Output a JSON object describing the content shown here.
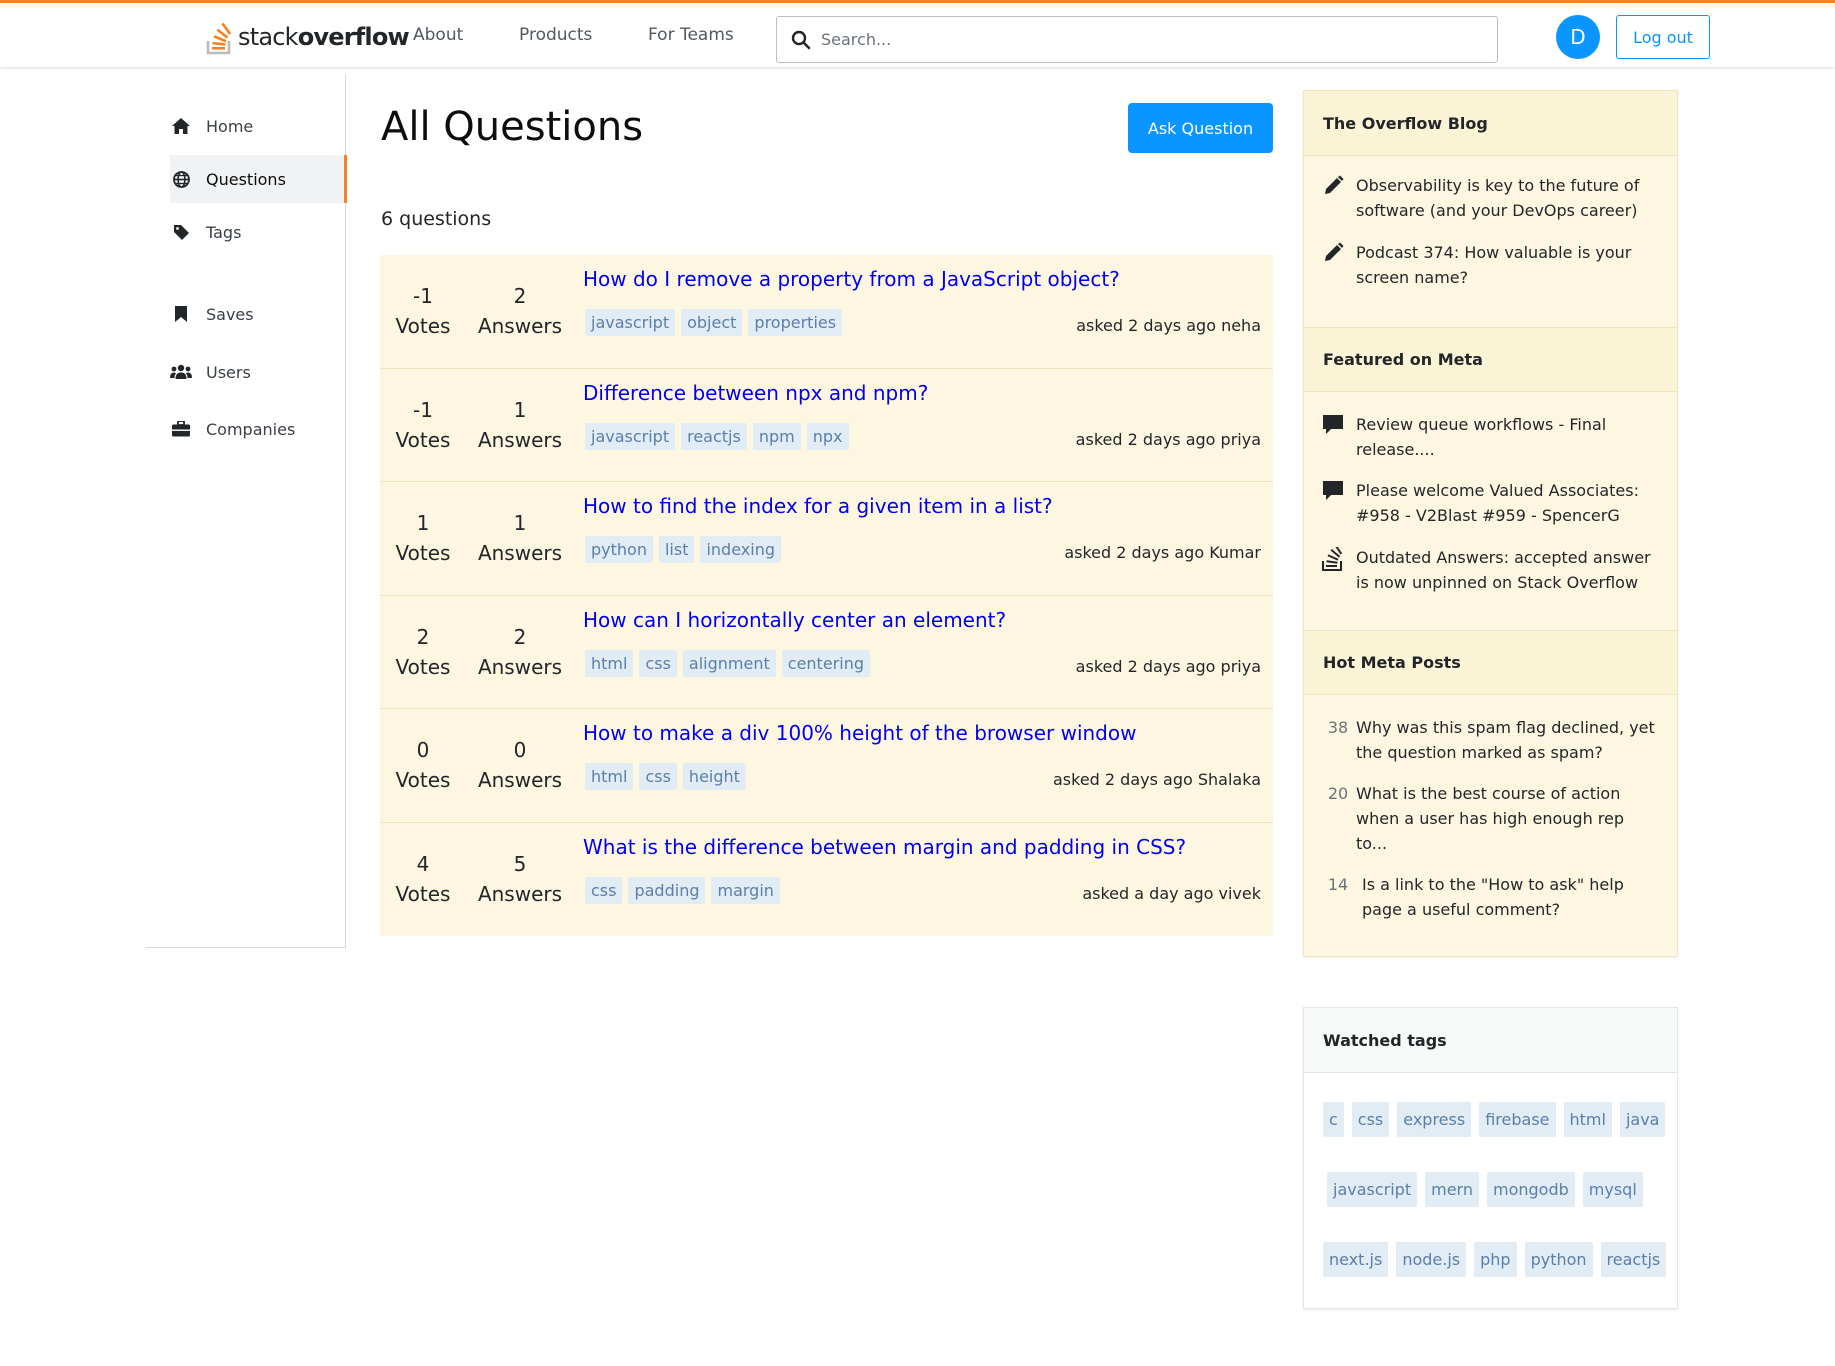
{
  "header": {
    "logo_prefix": "stack",
    "logo_suffix": "overflow",
    "nav": [
      "About",
      "Products",
      "For Teams"
    ],
    "search_placeholder": "Search...",
    "avatar_letter": "D",
    "logout_label": "Log out",
    "accent_color": "#f48225"
  },
  "sidebar": {
    "items": [
      {
        "label": "Home",
        "icon": "home-icon"
      },
      {
        "label": "Questions",
        "icon": "globe-icon",
        "active": true
      },
      {
        "label": "Tags",
        "icon": "tag-icon"
      },
      {
        "label": "Saves",
        "icon": "bookmark-icon"
      },
      {
        "label": "Users",
        "icon": "users-icon"
      },
      {
        "label": "Companies",
        "icon": "briefcase-icon"
      }
    ]
  },
  "main": {
    "title": "All Questions",
    "ask_label": "Ask Question",
    "count_text": "6 questions",
    "votes_label": "Votes",
    "answers_label": "Answers",
    "questions": [
      {
        "votes": "-1",
        "answers": "2",
        "title": "How do I remove a property from a JavaScript object?",
        "tags": [
          "javascript",
          "object",
          "properties"
        ],
        "asked": "asked 2 days ago neha"
      },
      {
        "votes": "-1",
        "answers": "1",
        "title": "Difference between npx and npm?",
        "tags": [
          "javascript",
          "reactjs",
          "npm",
          "npx"
        ],
        "asked": "asked 2 days ago priya"
      },
      {
        "votes": "1",
        "answers": "1",
        "title": "How to find the index for a given item in a list?",
        "tags": [
          "python",
          "list",
          "indexing"
        ],
        "asked": "asked 2 days ago Kumar"
      },
      {
        "votes": "2",
        "answers": "2",
        "title": "How can I horizontally center an element?",
        "tags": [
          "html",
          "css",
          "alignment",
          "centering"
        ],
        "asked": "asked 2 days ago priya"
      },
      {
        "votes": "0",
        "answers": "0",
        "title": "How to make a div 100% height of the browser window",
        "tags": [
          "html",
          "css",
          "height"
        ],
        "asked": "asked 2 days ago Shalaka"
      },
      {
        "votes": "4",
        "answers": "5",
        "title": "What is the difference between margin and padding in CSS?",
        "tags": [
          "css",
          "padding",
          "margin"
        ],
        "asked": "asked a day ago vivek"
      }
    ]
  },
  "right": {
    "blog_title": "The Overflow Blog",
    "blog_items": [
      "Observability is key to the future of software (and your DevOps career)",
      "Podcast 374: How valuable is your screen name?"
    ],
    "meta_title": "Featured on Meta",
    "meta_items": [
      {
        "text": "Review queue workflows - Final release....",
        "icon": "comment-icon"
      },
      {
        "text": "Please welcome Valued Associates: #958 - V2Blast #959 - SpencerG",
        "icon": "comment-icon"
      },
      {
        "text": "Outdated Answers: accepted answer is now unpinned on Stack Overflow",
        "icon": "stack-overflow-icon"
      }
    ],
    "hot_title": "Hot Meta Posts",
    "hot_items": [
      {
        "num": "38",
        "text": "Why was this spam flag declined, yet the question marked as spam?"
      },
      {
        "num": "20",
        "text": "What is the best course of action when a user has high enough rep to..."
      },
      {
        "num": "14",
        "text": "Is a link to the \"How to ask\" help page a useful comment?"
      }
    ],
    "watched_title": "Watched tags",
    "watched_rows": [
      [
        "c",
        "css",
        "express",
        "firebase",
        "html",
        "java"
      ],
      [
        "javascript",
        "mern",
        "mongodb",
        "mysql"
      ],
      [
        "next.js",
        "node.js",
        "php",
        "python",
        "reactjs"
      ]
    ]
  }
}
